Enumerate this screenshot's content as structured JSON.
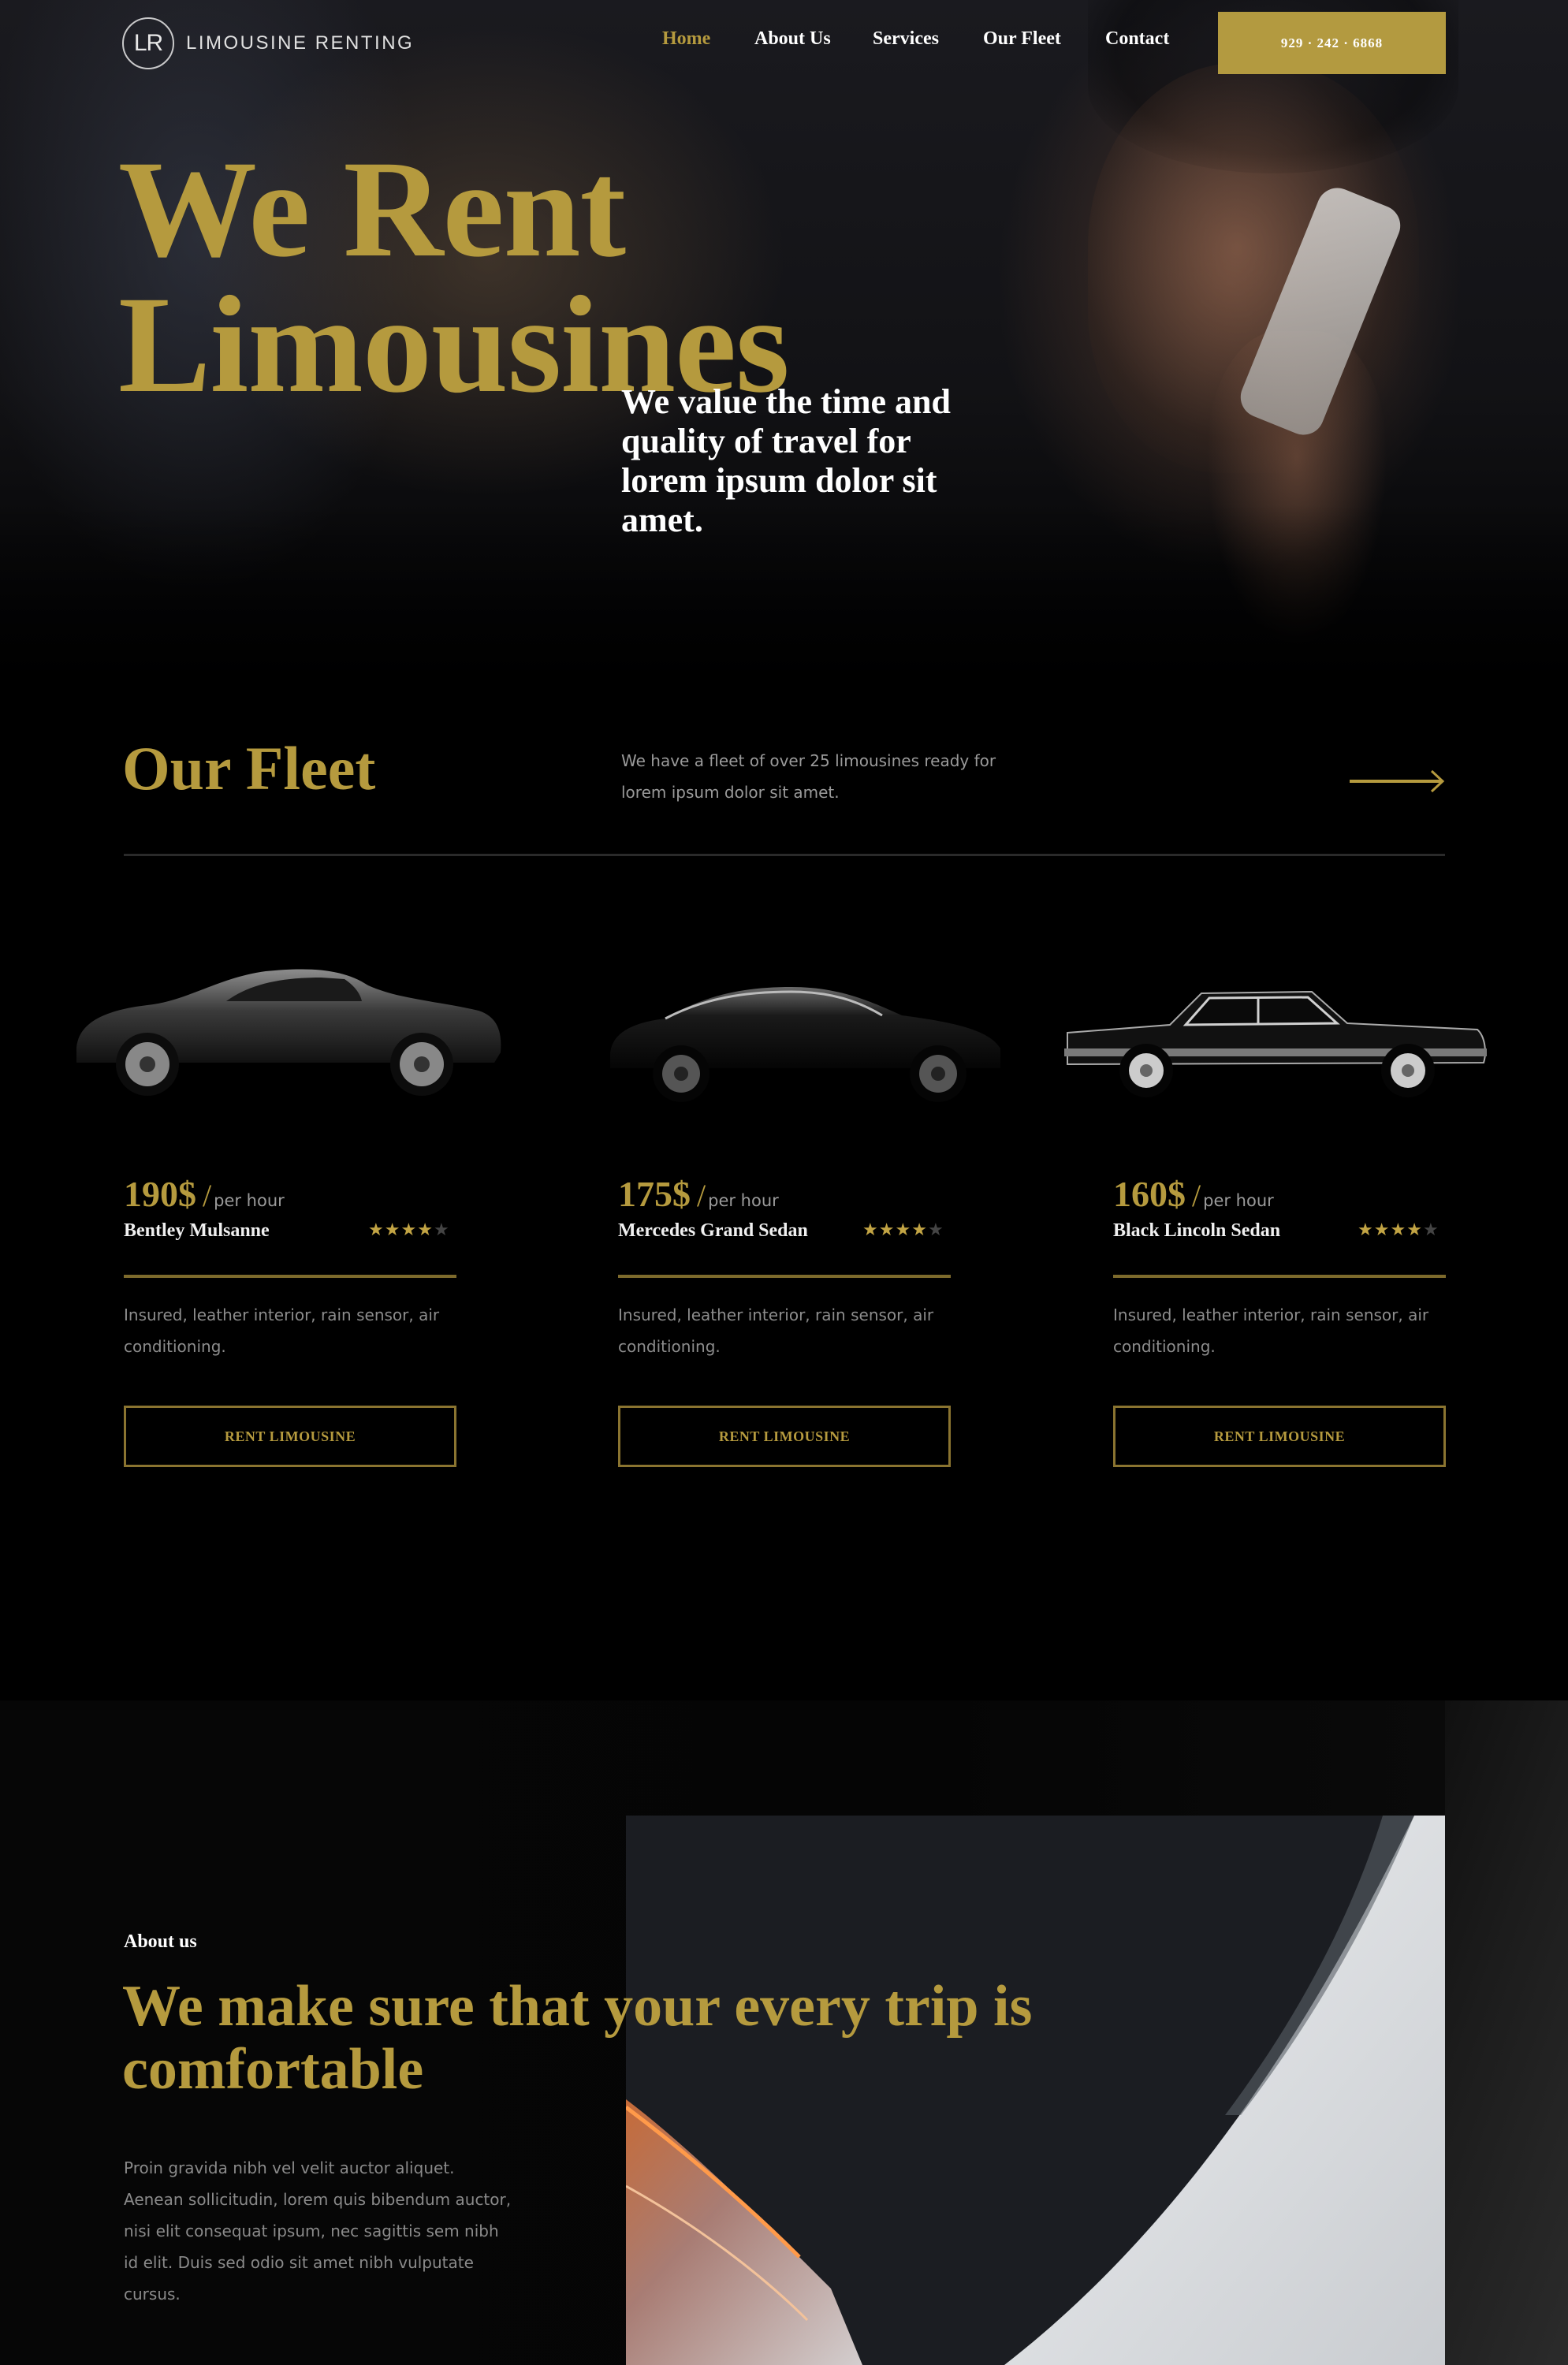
{
  "brand": {
    "logo_initials": "LR",
    "name": "LIMOUSINE RENTING"
  },
  "nav": {
    "items": [
      {
        "label": "Home",
        "active": true
      },
      {
        "label": "About Us",
        "active": false
      },
      {
        "label": "Services",
        "active": false
      },
      {
        "label": "Our Fleet",
        "active": false
      },
      {
        "label": "Contact",
        "active": false
      }
    ],
    "phone": "929 · 242 · 6868"
  },
  "hero": {
    "title_line1": "We Rent",
    "title_line2": "Limousines",
    "subtitle": "We value the time and quality of travel for lorem ipsum dolor sit amet."
  },
  "fleet": {
    "title": "Our Fleet",
    "description": "We have a fleet of over 25 limousines ready for lorem ipsum dolor sit amet.",
    "arrow_icon": "arrow-right-icon",
    "cars": [
      {
        "price": "190$",
        "per": "per hour",
        "name": "Bentley Mulsanne",
        "rating": 4,
        "rating_max": 5,
        "description": "Insured, leather interior, rain sensor, air conditioning.",
        "button": "RENT LIMOUSINE"
      },
      {
        "price": "175$",
        "per": "per hour",
        "name": "Mercedes Grand Sedan",
        "rating": 4,
        "rating_max": 5,
        "description": "Insured, leather interior, rain sensor, air conditioning.",
        "button": "RENT LIMOUSINE"
      },
      {
        "price": "160$",
        "per": "per hour",
        "name": "Black Lincoln Sedan",
        "rating": 4,
        "rating_max": 5,
        "description": "Insured, leather interior, rain sensor, air conditioning.",
        "button": "RENT LIMOUSINE"
      }
    ]
  },
  "about": {
    "label": "About us",
    "title": "We make sure that your every trip is comfortable",
    "text": "Proin gravida nibh vel velit auctor aliquet. Aenean sollicitudin, lorem quis bibendum auctor, nisi elit consequat ipsum, nec sagittis sem nibh id elit. Duis sed odio sit amet nibh vulputate cursus."
  },
  "colors": {
    "accent_gold": "#b59a3e",
    "button_gold": "#b39a40",
    "background": "#000000",
    "star_off": "#444444"
  }
}
